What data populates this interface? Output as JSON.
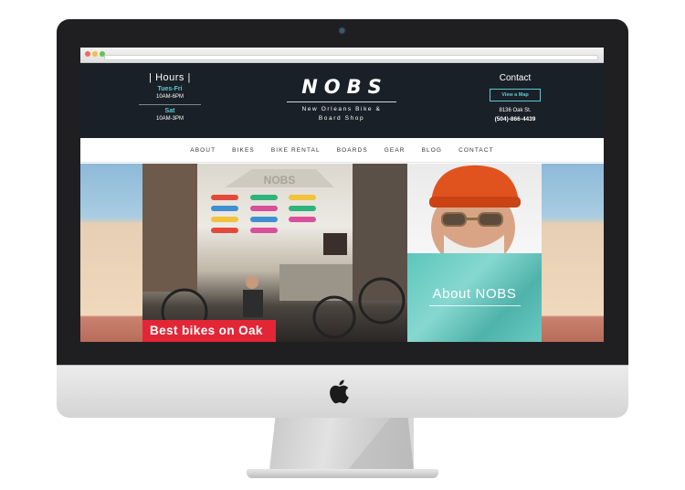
{
  "site": {
    "hours": {
      "title": "| Hours |",
      "weekday_label": "Tues-Fri",
      "weekday_time": "10AM-6PM",
      "sat_label": "Sat",
      "sat_time": "10AM-3PM"
    },
    "logo": {
      "name": "NOBS",
      "line1": "New Orleans Bike &",
      "line2": "Board Shop"
    },
    "contact": {
      "title": "Contact",
      "map_button": "View a Map",
      "address": "8136 Oak St.",
      "phone": "(504)-866-4439"
    },
    "menu": [
      "ABOUT",
      "BIKES",
      "BIKE RENTAL",
      "BOARDS",
      "GEAR",
      "BLOG",
      "CONTACT"
    ],
    "hero": {
      "caption": "Best bikes on Oak",
      "about_label": "About NOBS"
    }
  },
  "colors": {
    "header_bg": "#1a2027",
    "accent_teal": "#5fc8d5",
    "caption_red": "#e32636",
    "about_teal": "#5cc6bd"
  }
}
